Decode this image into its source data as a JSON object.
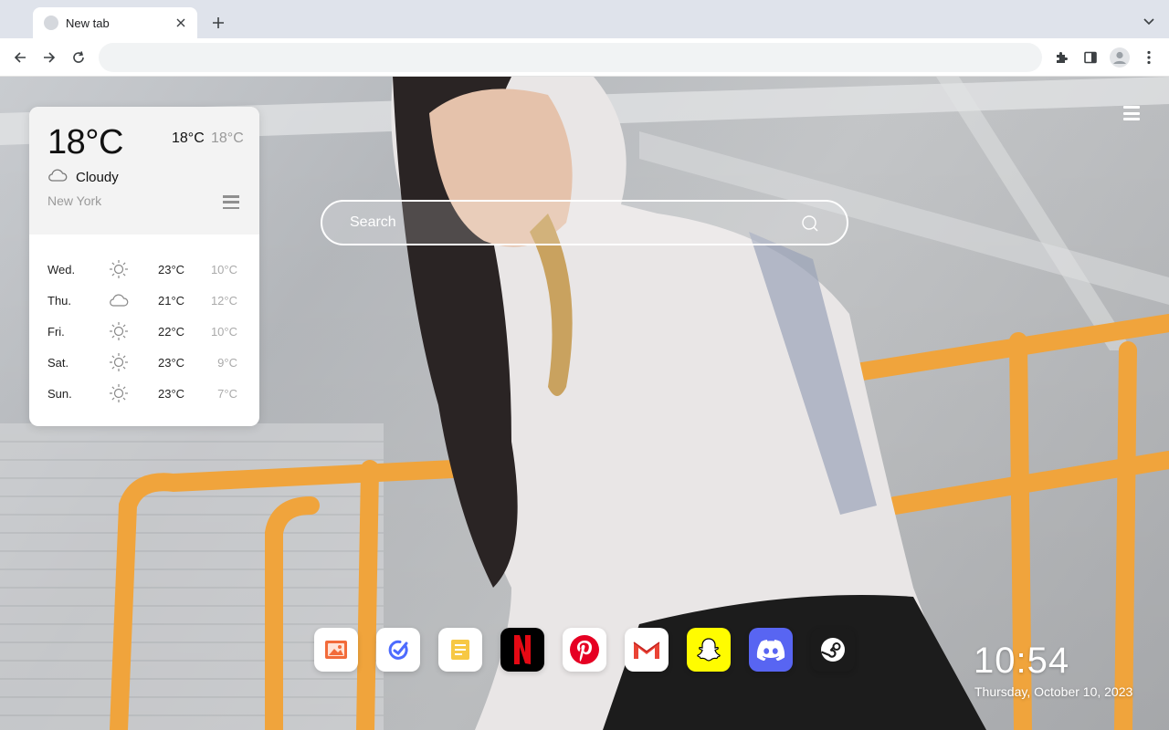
{
  "browser": {
    "tab": {
      "title": "New tab"
    },
    "omnibox": {
      "value": ""
    }
  },
  "weather": {
    "current_temp": "18°C",
    "high": "18°C",
    "low": "18°C",
    "condition": "Cloudy",
    "condition_icon": "cloud-icon",
    "city": "New York",
    "forecast": [
      {
        "day": "Wed.",
        "icon": "sun-icon",
        "high": "23°C",
        "low": "10°C"
      },
      {
        "day": "Thu.",
        "icon": "cloud-icon",
        "high": "21°C",
        "low": "12°C"
      },
      {
        "day": "Fri.",
        "icon": "sun-icon",
        "high": "22°C",
        "low": "10°C"
      },
      {
        "day": "Sat.",
        "icon": "sun-icon",
        "high": "23°C",
        "low": "9°C"
      },
      {
        "day": "Sun.",
        "icon": "sun-icon",
        "high": "23°C",
        "low": "7°C"
      }
    ]
  },
  "search": {
    "placeholder": "Search"
  },
  "dock": {
    "apps": [
      {
        "name": "wallpaper-app-icon",
        "color": "#ffffff"
      },
      {
        "name": "tasks-app-icon",
        "color": "#ffffff"
      },
      {
        "name": "notes-app-icon",
        "color": "#ffffff"
      },
      {
        "name": "netflix-icon",
        "color": "#000000"
      },
      {
        "name": "pinterest-icon",
        "color": "#ffffff"
      },
      {
        "name": "gmail-icon",
        "color": "#ffffff"
      },
      {
        "name": "snapchat-icon",
        "color": "#fffc00"
      },
      {
        "name": "discord-icon",
        "color": "#5865f2"
      },
      {
        "name": "steam-icon",
        "color": "#1b1b1b"
      }
    ]
  },
  "clock": {
    "time": "10:54",
    "date": "Thursday, October 10, 2023"
  },
  "colors": {
    "tabstrip": "#dfe3eb",
    "toolbar": "#ffffff",
    "widget": "#ffffff",
    "text_muted": "#999999"
  }
}
